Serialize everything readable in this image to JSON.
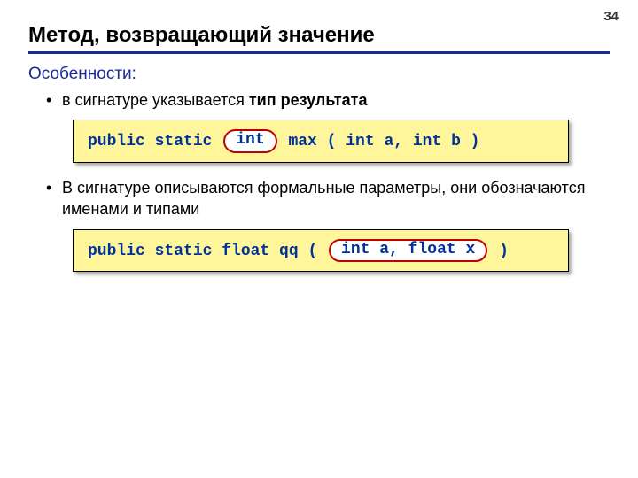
{
  "pageNumber": "34",
  "title": "Метод, возвращающий значение",
  "subhead": "Особенности:",
  "bullets": {
    "b1_pre": "в сигнатуре указывается ",
    "b1_bold": "тип результата",
    "b2": "В сигнатуре описываются формальные параметры, они обозначаются именами и типами"
  },
  "code1": {
    "pre": "public static ",
    "pill": "int",
    "post": " max ( int a, int b )"
  },
  "code2": {
    "pre": "public static float qq ( ",
    "pill": "int a, float x",
    "post": " )"
  }
}
